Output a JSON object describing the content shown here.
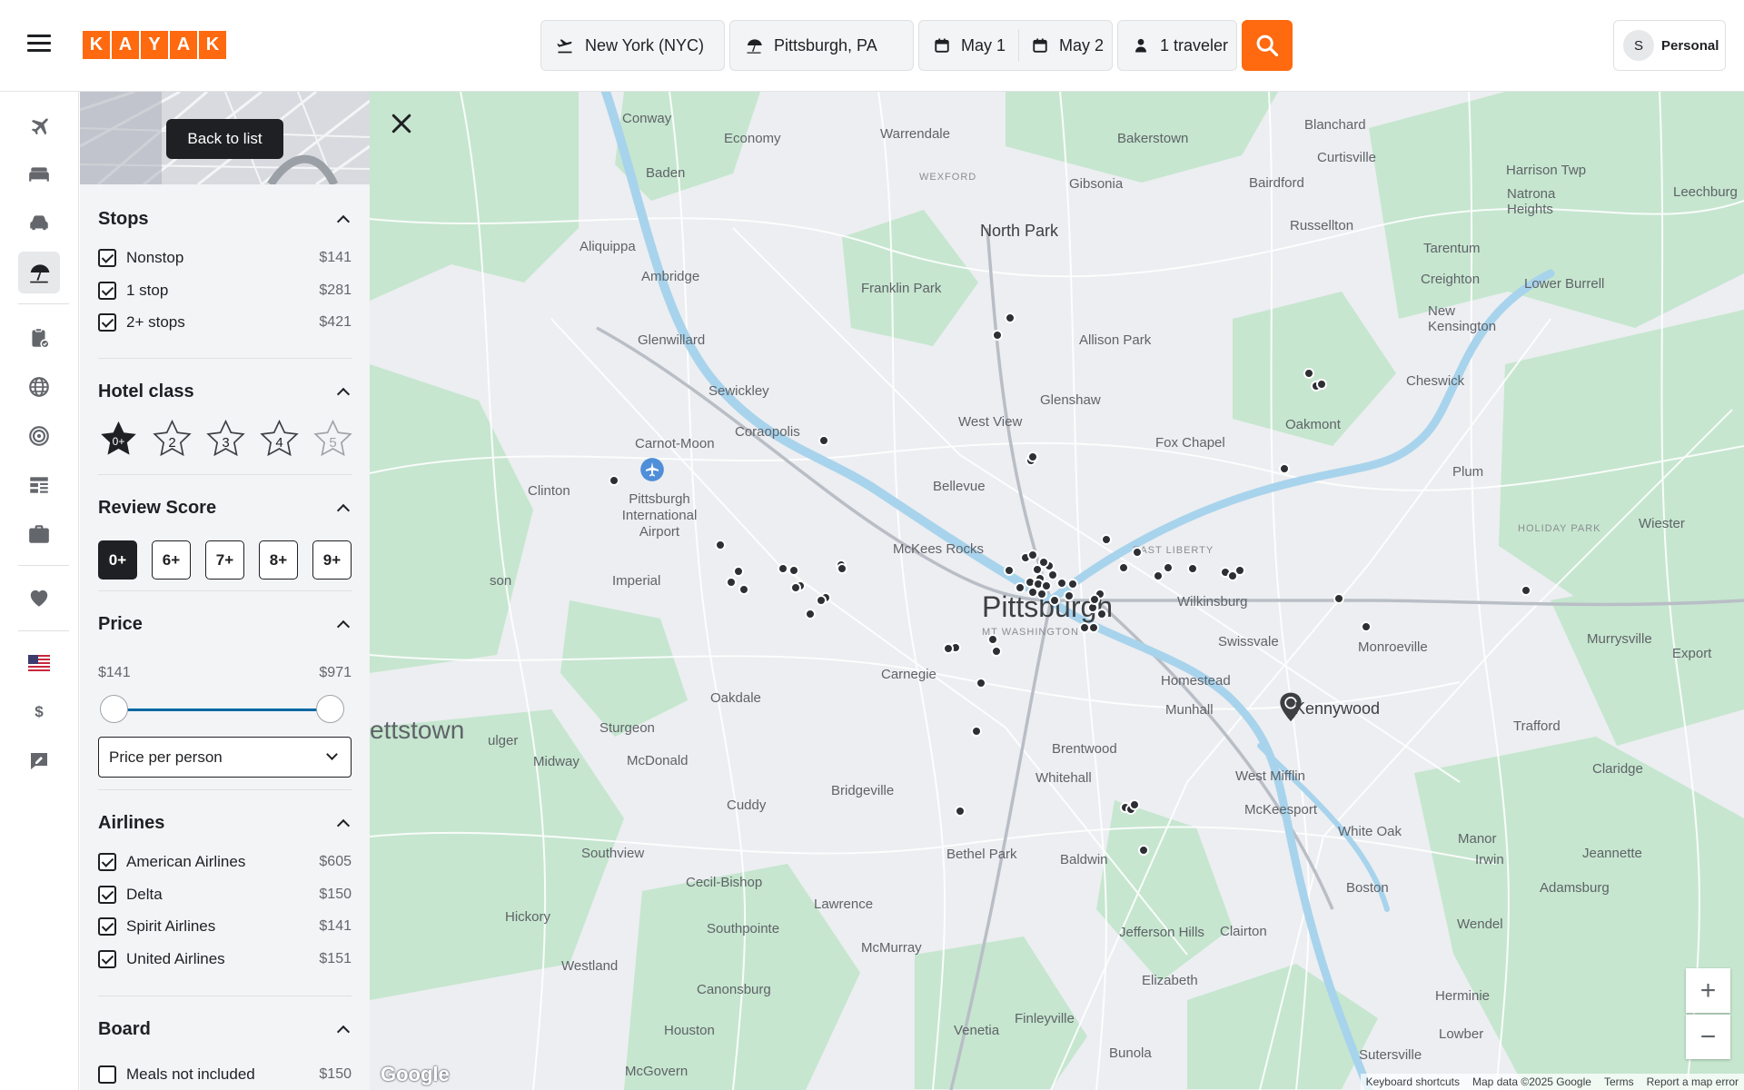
{
  "brand": {
    "logo_letters": [
      "K",
      "A",
      "Y",
      "A",
      "K"
    ],
    "accent": "#ff690f"
  },
  "search": {
    "origin": "New York (NYC)",
    "destination": "Pittsburgh, PA",
    "depart": "May 1",
    "return": "May 2",
    "travelers": "1 traveler"
  },
  "profile": {
    "initial": "S",
    "label": "Personal"
  },
  "nav_icons": [
    "plane-icon",
    "bed-icon",
    "car-icon",
    "beach-umbrella-icon",
    "clipboard-check-icon",
    "globe-icon",
    "target-icon",
    "news-icon",
    "briefcase-icon",
    "heart-icon",
    "us-flag-icon",
    "dollar-icon",
    "feedback-icon"
  ],
  "nav_currency_symbol": "$",
  "back_to_list": "Back to list",
  "filters": {
    "stops": {
      "title": "Stops",
      "options": [
        {
          "label": "Nonstop",
          "price": "$141",
          "checked": true
        },
        {
          "label": "1 stop",
          "price": "$281",
          "checked": true
        },
        {
          "label": "2+ stops",
          "price": "$421",
          "checked": true
        }
      ]
    },
    "hotel_class": {
      "title": "Hotel class",
      "stars": [
        "0+",
        "2",
        "3",
        "4",
        "5"
      ],
      "selected": "0+"
    },
    "review_score": {
      "title": "Review Score",
      "options": [
        "0+",
        "6+",
        "7+",
        "8+",
        "9+"
      ],
      "selected": "0+"
    },
    "price": {
      "title": "Price",
      "min": "$141",
      "max": "$971",
      "mode": "Price per person"
    },
    "airlines": {
      "title": "Airlines",
      "options": [
        {
          "label": "American Airlines",
          "price": "$605",
          "checked": true
        },
        {
          "label": "Delta",
          "price": "$150",
          "checked": true
        },
        {
          "label": "Spirit Airlines",
          "price": "$141",
          "checked": true
        },
        {
          "label": "United Airlines",
          "price": "$151",
          "checked": true
        }
      ]
    },
    "board": {
      "title": "Board",
      "options": [
        {
          "label": "Meals not included",
          "price": "$150",
          "checked": false
        }
      ]
    }
  },
  "map": {
    "labels": [
      "Conway",
      "Economy",
      "Warrendale",
      "Bakerstown",
      "Blanchard",
      "Baden",
      "Curtisville",
      "Harrison Twp",
      "Natrona Heights",
      "Leechburg",
      "WEXFORD",
      "Gibsonia",
      "Bairdford",
      "Aliquippa",
      "North Park",
      "Russellton",
      "Tarentum",
      "Ambridge",
      "Franklin Park",
      "Creighton",
      "Lower Burrell",
      "New Kensington",
      "Glenwillard",
      "Allison Park",
      "Cheswick",
      "Sewickley",
      "Glenshaw",
      "Oakmont",
      "West View",
      "Coraopolis",
      "Carnot-Moon",
      "Fox Chapel",
      "Clinton",
      "Bellevue",
      "Plum",
      "Pittsburgh International Airport",
      "HOLIDAY PARK",
      "Wiester",
      "McKees Rocks",
      "EAST LIBERTY",
      "son",
      "Imperial",
      "Pittsburgh",
      "Wilkinsburg",
      "MT WASHINGTON",
      "Murrysville",
      "Swissvale",
      "Monroeville",
      "Export",
      "Carnegie",
      "Homestead",
      "Kennywood",
      "Munhall",
      "Trafford",
      "ettstown",
      "Oakdale",
      "Sturgeon",
      "Brentwood",
      "Midway",
      "McDonald",
      "Whitehall",
      "West Mifflin",
      "Claridge",
      "Bridgeville",
      "Cuddy",
      "McKeesport",
      "White Oak",
      "Manor",
      "Southview",
      "Baldwin",
      "Bethel Park",
      "Jeannette",
      "Irwin",
      "Cecil-Bishop",
      "Adamsburg",
      "Boston",
      "Hickory",
      "Lawrence",
      "Southpointe",
      "Jefferson Hills",
      "Wendel",
      "Clairton",
      "McMurray",
      "Westland",
      "Elizabeth",
      "Canonsburg",
      "Herminie",
      "Houston",
      "Venetia",
      "Finleyville",
      "Lowber",
      "Sutersville",
      "Bunola",
      "McGovern",
      "ulger"
    ],
    "zoom_in": "+",
    "zoom_out": "−",
    "google": "Google",
    "footer": [
      "Keyboard shortcuts",
      "Map data ©2025 Google",
      "Terms",
      "Report a map error"
    ]
  }
}
